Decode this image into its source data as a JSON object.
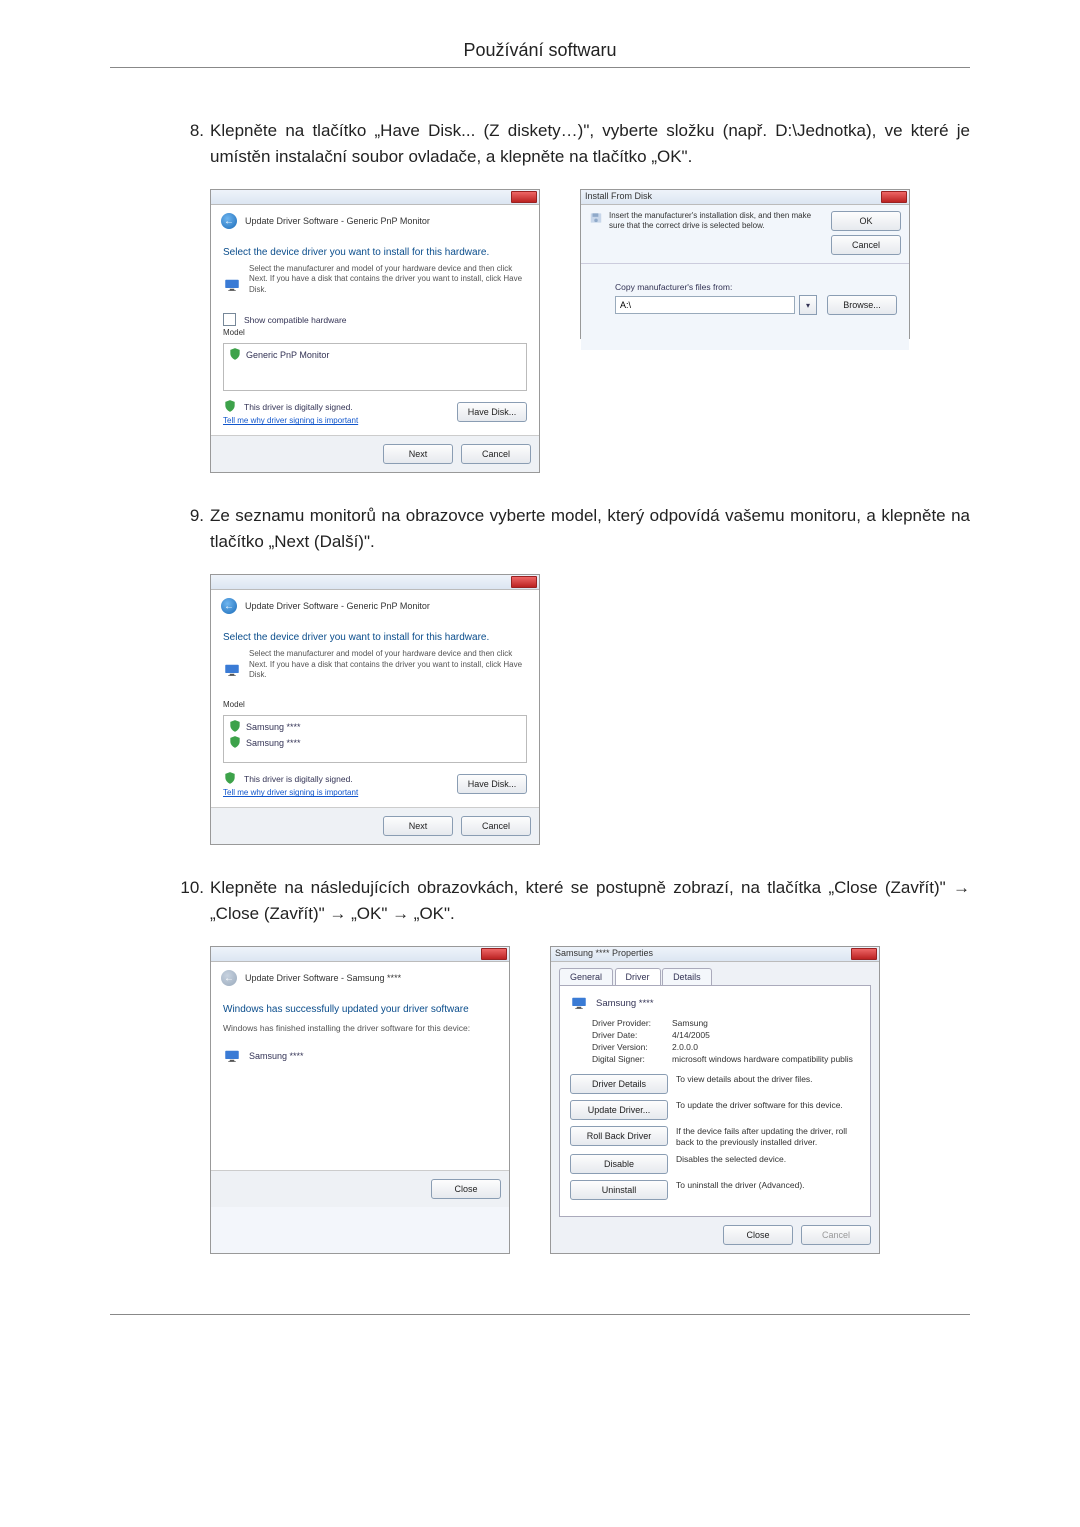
{
  "header": {
    "title": "Používání softwaru"
  },
  "steps": {
    "s8": {
      "num": "8.",
      "text": "Klepněte na tlačítko „Have Disk... (Z diskety…)\", vyberte složku (např. D:\\Jednotka), ve které je umístěn instalační soubor ovladače, a klepněte na tlačítko „OK\"."
    },
    "s9": {
      "num": "9.",
      "text": "Ze seznamu monitorů na obrazovce vyberte model, který odpovídá vašemu monitoru, a klepněte na tlačítko „Next (Další)\"."
    },
    "s10": {
      "num": "10.",
      "text": "Klepněte na následujících obrazovkách, které se postupně zobrazí, na tlačítka „Close (Zavřít)\" → „Close (Zavřít)\" → „OK\" → „OK\"."
    }
  },
  "dlg_update_generic": {
    "breadcrumb": "Update Driver Software - Generic PnP Monitor",
    "heading": "Select the device driver you want to install for this hardware.",
    "sub": "Select the manufacturer and model of your hardware device and then click Next. If you have a disk that contains the driver you want to install, click Have Disk.",
    "checkbox": "Show compatible hardware",
    "list_label": "Model",
    "list_item": "Generic PnP Monitor",
    "signed": "This driver is digitally signed.",
    "tell_me": "Tell me why driver signing is important",
    "have_disk": "Have Disk...",
    "next": "Next",
    "cancel": "Cancel"
  },
  "dlg_install_disk": {
    "title": "Install From Disk",
    "msg": "Insert the manufacturer's installation disk, and then make sure that the correct drive is selected below.",
    "ok": "OK",
    "cancel": "Cancel",
    "copy_label": "Copy manufacturer's files from:",
    "path": "A:\\",
    "browse": "Browse..."
  },
  "dlg_update_samsung_list": {
    "breadcrumb": "Update Driver Software - Generic PnP Monitor",
    "heading": "Select the device driver you want to install for this hardware.",
    "sub": "Select the manufacturer and model of your hardware device and then click Next. If you have a disk that contains the driver you want to install, click Have Disk.",
    "list_label": "Model",
    "item1": "Samsung ****",
    "item2": "Samsung ****",
    "signed": "This driver is digitally signed.",
    "tell_me": "Tell me why driver signing is important",
    "have_disk": "Have Disk...",
    "next": "Next",
    "cancel": "Cancel"
  },
  "dlg_update_success": {
    "breadcrumb": "Update Driver Software - Samsung ****",
    "heading": "Windows has successfully updated your driver software",
    "sub": "Windows has finished installing the driver software for this device:",
    "device": "Samsung ****",
    "close": "Close"
  },
  "dlg_properties": {
    "title": "Samsung **** Properties",
    "tab_general": "General",
    "tab_driver": "Driver",
    "tab_details": "Details",
    "device": "Samsung ****",
    "provider_k": "Driver Provider:",
    "provider_v": "Samsung",
    "date_k": "Driver Date:",
    "date_v": "4/14/2005",
    "version_k": "Driver Version:",
    "version_v": "2.0.0.0",
    "signer_k": "Digital Signer:",
    "signer_v": "microsoft windows hardware compatibility publis",
    "btn_details": "Driver Details",
    "desc_details": "To view details about the driver files.",
    "btn_update": "Update Driver...",
    "desc_update": "To update the driver software for this device.",
    "btn_rollback": "Roll Back Driver",
    "desc_rollback": "If the device fails after updating the driver, roll back to the previously installed driver.",
    "btn_disable": "Disable",
    "desc_disable": "Disables the selected device.",
    "btn_uninstall": "Uninstall",
    "desc_uninstall": "To uninstall the driver (Advanced).",
    "close": "Close",
    "cancel": "Cancel"
  }
}
